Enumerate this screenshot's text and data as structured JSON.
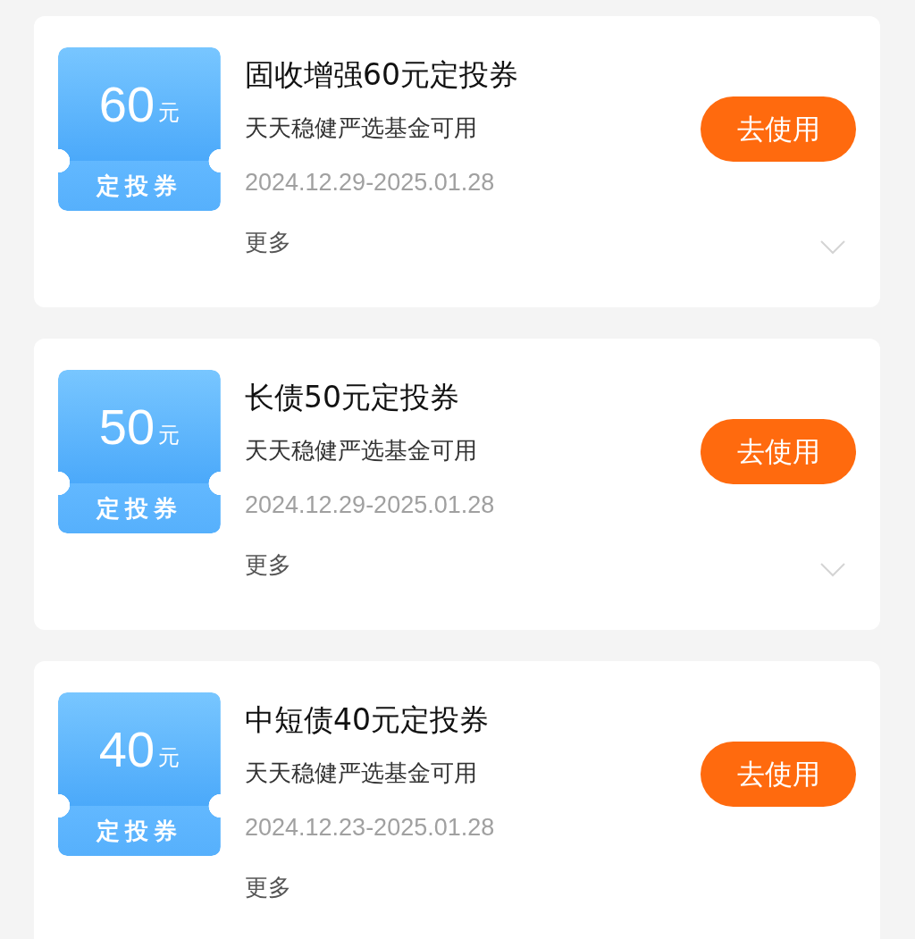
{
  "coupons": [
    {
      "amount": "60",
      "unit": "元",
      "ticket_label": "定投券",
      "title": "固收增强60元定投券",
      "subtitle": "天天稳健严选基金可用",
      "dates": "2024.12.29-2025.01.28",
      "more": "更多",
      "button": "去使用",
      "expanded": false
    },
    {
      "amount": "50",
      "unit": "元",
      "ticket_label": "定投券",
      "title": "长债50元定投券",
      "subtitle": "天天稳健严选基金可用",
      "dates": "2024.12.29-2025.01.28",
      "more": "更多",
      "button": "去使用",
      "expanded": false
    },
    {
      "amount": "40",
      "unit": "元",
      "ticket_label": "定投券",
      "title": "中短债40元定投券",
      "subtitle": "天天稳健严选基金可用",
      "dates": "2024.12.23-2025.01.28",
      "more": "更多",
      "button": "去使用"
    }
  ]
}
